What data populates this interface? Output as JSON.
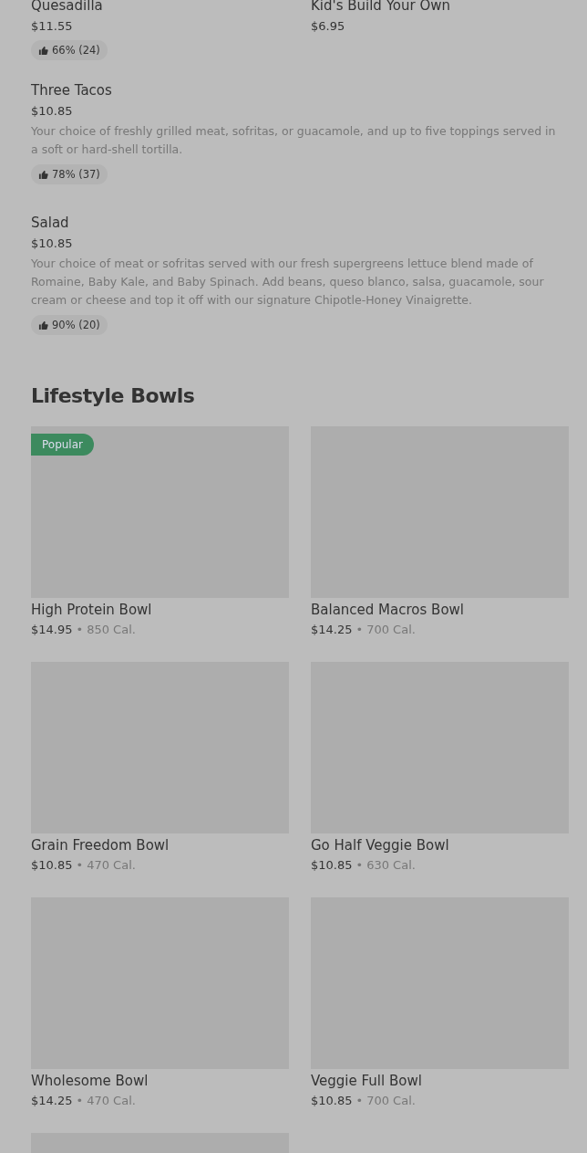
{
  "top_items": [
    {
      "name": "Quesadilla",
      "price": "$11.55",
      "rating": "66% (24)"
    },
    {
      "name": "Kid's Build Your Own",
      "price": "$6.95"
    }
  ],
  "items": [
    {
      "name": "Three Tacos",
      "price": "$10.85",
      "description": "Your choice of freshly grilled meat, sofritas, or guacamole, and up to five toppings served in a soft or hard-shell tortilla.",
      "rating": "78% (37)"
    },
    {
      "name": "Salad",
      "price": "$10.85",
      "description": "Your choice of meat or sofritas served with our fresh supergreens lettuce blend made of Romaine, Baby Kale, and Baby Spinach. Add beans, queso blanco, salsa, guacamole, sour cream or cheese and top it off with our signature Chipotle-Honey Vinaigrette.",
      "rating": "90% (20)"
    }
  ],
  "section": {
    "title": "Lifestyle Bowls",
    "bowls": [
      {
        "kind": "item",
        "badge": "Popular",
        "name": "High Protein Bowl",
        "price": "$14.95",
        "separator": "•",
        "calories": "850 Cal."
      },
      {
        "kind": "item",
        "name": "Balanced Macros Bowl",
        "price": "$14.25",
        "separator": "•",
        "calories": "700 Cal."
      },
      {
        "kind": "item",
        "name": "Grain Freedom Bowl",
        "price": "$10.85",
        "separator": "•",
        "calories": "470 Cal."
      },
      {
        "kind": "item",
        "name": "Go Half Veggie Bowl",
        "price": "$10.85",
        "separator": "•",
        "calories": "630 Cal."
      },
      {
        "kind": "item",
        "name": "Wholesome Bowl",
        "price": "$14.25",
        "separator": "•",
        "calories": "470 Cal."
      },
      {
        "kind": "item",
        "name": "Veggie Full Bowl",
        "price": "$10.85",
        "separator": "•",
        "calories": "700 Cal."
      },
      {
        "kind": "picture"
      }
    ]
  }
}
